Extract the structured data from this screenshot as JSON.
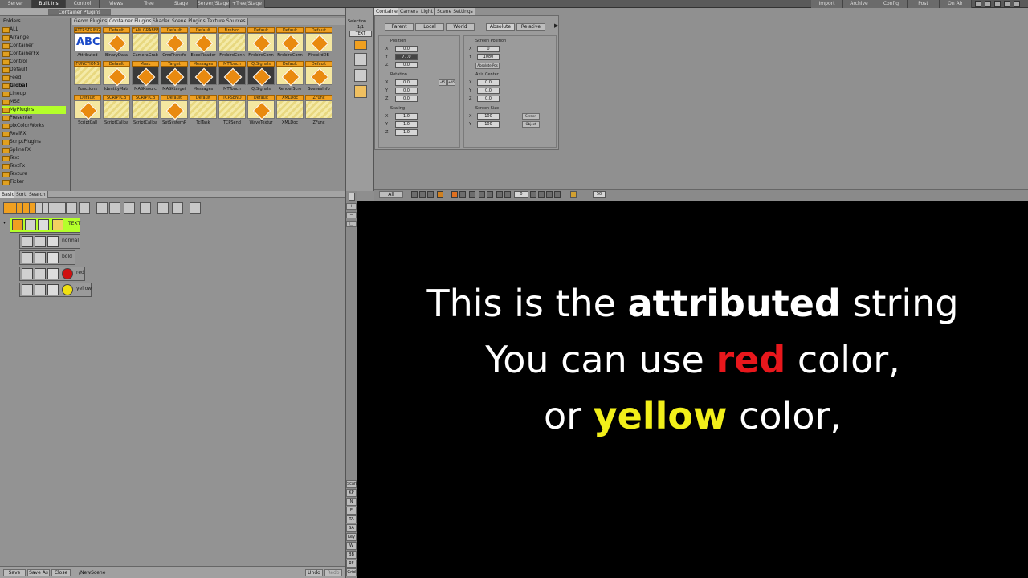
{
  "menubar": {
    "tabs": [
      "Server",
      "Built Ins",
      "Control",
      "Views",
      "Tree",
      "Stage",
      "Server/Stage",
      "+Tree/Stage"
    ],
    "right": [
      "Import",
      "Archive",
      "Config",
      "Post",
      "On Air"
    ]
  },
  "builtins": {
    "folders_header": "Folders",
    "folders": [
      "ALL",
      "Arrange",
      "Container",
      "ContainerFx",
      "Control",
      "Default",
      "Feed",
      "Global",
      "Lineup",
      "MSE",
      "MyPlugins",
      "Presenter",
      "pixColorWorks",
      "RealFX",
      "ScriptPlugins",
      "SplineFX",
      "Text",
      "TextFx",
      "Texture",
      "Ticker"
    ],
    "selected_folder": "MyPlugins",
    "tabs": [
      "Geom Plugins",
      "Container Plugins",
      "Shader",
      "Scene Plugins",
      "Texture Sources"
    ],
    "dropdown": "Container Plugins",
    "plugins": [
      {
        "cap": "ATTRSTRING",
        "lbl": "Attributed"
      },
      {
        "cap": "Default",
        "lbl": "BinaryData"
      },
      {
        "cap": "CAM.GRABBER",
        "lbl": "CameraGrab"
      },
      {
        "cap": "Default",
        "lbl": "CmdTransfo"
      },
      {
        "cap": "Default",
        "lbl": "ExcelReader"
      },
      {
        "cap": "Firebird",
        "lbl": "FirebirdConn"
      },
      {
        "cap": "Default",
        "lbl": "FirebirdConn"
      },
      {
        "cap": "Default",
        "lbl": "FirebirdConn"
      },
      {
        "cap": "Default",
        "lbl": "FirebirdDB"
      },
      {
        "cap": "FUNCTIONS",
        "lbl": "Functions"
      },
      {
        "cap": "Default",
        "lbl": "IdentityMatr"
      },
      {
        "cap": "Mask",
        "lbl": "MASKsourc"
      },
      {
        "cap": "Target",
        "lbl": "MASKtarget"
      },
      {
        "cap": "Messages",
        "lbl": "Messages"
      },
      {
        "cap": "MTTouch",
        "lbl": "MTTouch"
      },
      {
        "cap": "QtSignals",
        "lbl": "QtSignals"
      },
      {
        "cap": "Default",
        "lbl": "RenderScre"
      },
      {
        "cap": "Default",
        "lbl": "ScenesInfo"
      },
      {
        "cap": "Default",
        "lbl": "ScriptCall"
      },
      {
        "cap": "SCRIPTCB",
        "lbl": "ScriptCallba"
      },
      {
        "cap": "SCRIPTCB",
        "lbl": "ScriptCallba"
      },
      {
        "cap": "Default",
        "lbl": "SetSystemP"
      },
      {
        "cap": "Default",
        "lbl": "TclTask"
      },
      {
        "cap": "TCPSEND",
        "lbl": "TCPSend"
      },
      {
        "cap": "Default",
        "lbl": "WaveTextur"
      },
      {
        "cap": "XMLDoc",
        "lbl": "XMLDoc"
      },
      {
        "cap": "ZFunc",
        "lbl": "ZFunc"
      }
    ]
  },
  "selection": {
    "title": "Selection",
    "count": "1/1",
    "name": "TEXT"
  },
  "editor": {
    "tabs": [
      "Container",
      "Camera",
      "Light",
      "Scene Settings"
    ],
    "space_buttons": [
      "Parent",
      "Local",
      "World"
    ],
    "mode_buttons": [
      "Absolute",
      "Relative"
    ],
    "position": {
      "label": "Position",
      "x": "0.0",
      "y": "77.0",
      "z": "0.0"
    },
    "rotation": {
      "label": "Rotation",
      "x": "0.0",
      "y": "0.0",
      "z": "0.0",
      "btns": [
        "-45",
        "+45"
      ]
    },
    "scaling": {
      "label": "Scaling",
      "x": "1.0",
      "y": "1.0",
      "z": "1.0"
    },
    "screen_position": {
      "label": "Screen Position",
      "x": "0",
      "y": "1080",
      "btn": "Absolute Pos"
    },
    "axis_center": {
      "label": "Axis Center",
      "x": "0.0",
      "y": "0.0",
      "z": "0.0"
    },
    "screen_size": {
      "label": "Screen Size",
      "x": "100",
      "y": "100",
      "btns": [
        "Screen",
        "Object"
      ]
    }
  },
  "tree": {
    "tabs": [
      "Basic",
      "Sort",
      "Search"
    ],
    "root_label": "TEXT",
    "children": [
      "normal",
      "bold",
      "red",
      "yellow"
    ],
    "footer": [
      "Save",
      "Save As",
      "Close"
    ],
    "scene_path": "/NewScene",
    "undo": "Undo",
    "redo": "Redo"
  },
  "timeline": {
    "layer": "All",
    "frame": "0",
    "length": "50"
  },
  "side_buttons": [
    "Scan",
    "KP",
    "N",
    "E",
    "TA",
    "SA",
    "Key",
    "W",
    "BB",
    "RF",
    "Grid"
  ],
  "render": {
    "line1_pre": "This is the ",
    "line1_bold": "attributed",
    "line1_post": " string",
    "line2_pre": "You can use ",
    "line2_red": "red",
    "line2_post": " color,",
    "line3_pre": "or ",
    "line3_yellow": "yellow",
    "line3_post": " color,"
  },
  "colors": {
    "canvas": "#000000",
    "red": "#e8171c",
    "yellow": "#f2ef1a",
    "selection": "#b4ff2a",
    "plugin_orange": "#f0a020"
  }
}
